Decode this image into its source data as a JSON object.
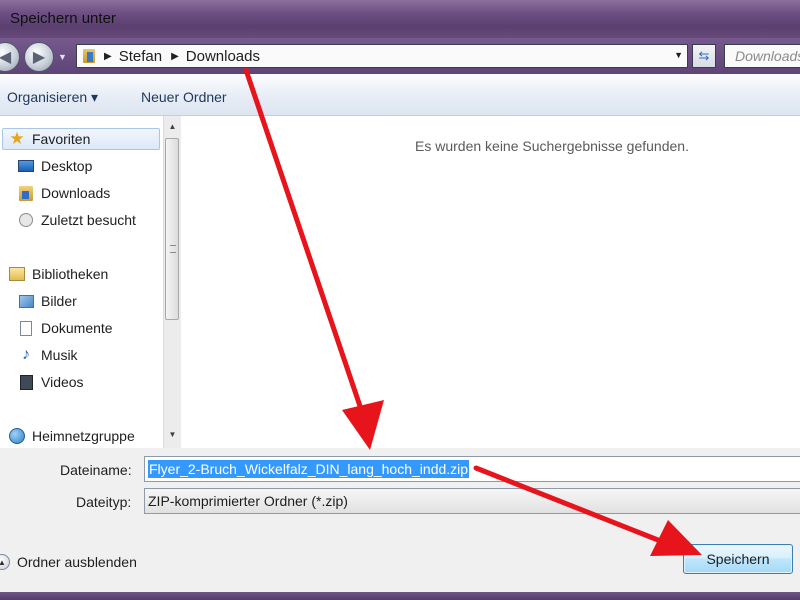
{
  "window": {
    "title": "Speichern unter"
  },
  "address_bar": {
    "breadcrumbs": [
      "Stefan",
      "Downloads"
    ],
    "search_placeholder": "Downloads"
  },
  "toolbar": {
    "organize_label": "Organisieren ▾",
    "new_folder_label": "Neuer Ordner"
  },
  "nav_pane": {
    "groups": [
      {
        "label": "Favoriten",
        "icon": "star-icon",
        "items": [
          {
            "label": "Desktop",
            "icon": "desktop-icon"
          },
          {
            "label": "Downloads",
            "icon": "downloads-folder-icon"
          },
          {
            "label": "Zuletzt besucht",
            "icon": "recent-places-icon"
          }
        ]
      },
      {
        "label": "Bibliotheken",
        "icon": "library-icon",
        "items": [
          {
            "label": "Bilder",
            "icon": "pictures-icon"
          },
          {
            "label": "Dokumente",
            "icon": "documents-icon"
          },
          {
            "label": "Musik",
            "icon": "music-icon"
          },
          {
            "label": "Videos",
            "icon": "videos-icon"
          }
        ]
      },
      {
        "label": "Heimnetzgruppe",
        "icon": "homegroup-icon",
        "items": []
      }
    ]
  },
  "content": {
    "empty_message": "Es wurden keine Suchergebnisse gefunden."
  },
  "form": {
    "filename_label": "Dateiname:",
    "filename_value": "Flyer_2-Bruch_Wickelfalz_DIN_lang_hoch_indd.zip",
    "filetype_label": "Dateityp:",
    "filetype_value": "ZIP-komprimierter Ordner (*.zip)",
    "hide_folders_label": "Ordner ausblenden",
    "save_label": "Speichern"
  },
  "colors": {
    "arrow": "#e8141c",
    "selection": "#3399ff",
    "button_border": "#3c7fb1"
  }
}
